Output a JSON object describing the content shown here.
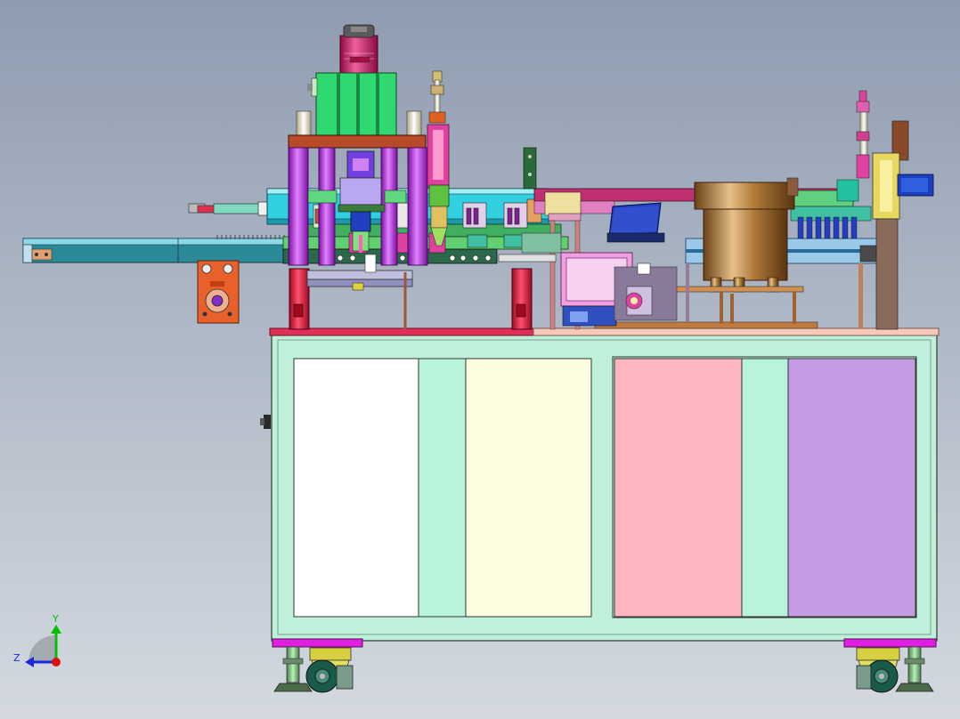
{
  "viewport": {
    "background_top": "#8f9cb0",
    "background_bottom": "#d4d9e0"
  },
  "triad": {
    "y_label": "Y",
    "z_label": "Z",
    "y_color": "#00c000",
    "z_color": "#1a2ad6",
    "x_color": "#e01010"
  },
  "colors": {
    "cabinet": "#bff0da",
    "cabinet_outline": "#4a5a50",
    "panel_white": "#ffffff",
    "panel_cream": "#fdfde0",
    "panel_pink": "#ffb6c1",
    "panel_purple": "#c39be3",
    "panel_mint": "#b8f4dc",
    "top_rail_red": "#e0305a",
    "top_rail_peach": "#f8c8b8",
    "foot_magenta": "#e020e0",
    "press_green": "#2fd870",
    "press_plate": "#b84a2a",
    "column_violet": "#c040e0",
    "column_cream": "#f4f0d0",
    "cyl_magenta": "#d02070",
    "conveyor_teal": "#2a8a9a",
    "bowl_bronze": "#b07a3a",
    "bracket_orange": "#e8602a",
    "blue_plate": "#2040c0",
    "slide_green": "#40c060",
    "brown": "#8a5a3a",
    "navy": "#1a2a6a"
  }
}
